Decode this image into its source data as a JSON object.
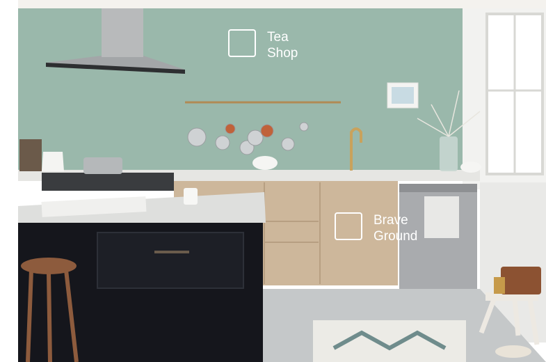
{
  "image": {
    "description_kind": "interior-photo",
    "colors": {
      "wall": "#9ab8ab",
      "cabinet": "#cdb79b",
      "island": "#15161c",
      "countertop": "#e6e6e3",
      "floor": "#c5c8c9",
      "window_frame": "#f2f2f0",
      "label": "#ffffff"
    }
  },
  "labels": [
    {
      "line1": "Tea",
      "line2": "Shop",
      "swatch_color": "#9ab8ab"
    },
    {
      "line1": "Brave",
      "line2": "Ground",
      "swatch_color": "#cdb79b"
    }
  ]
}
